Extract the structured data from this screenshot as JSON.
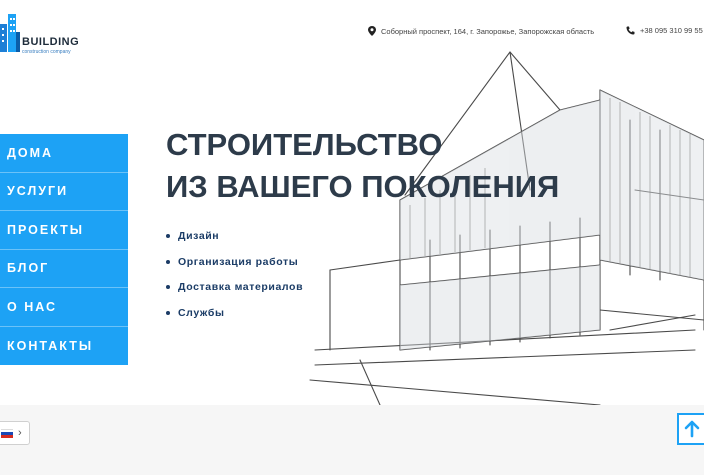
{
  "logo": {
    "title": "BUILDING",
    "subtitle": "construction company"
  },
  "header": {
    "address": "Соборный проспект, 164, г. Запорожье, Запорожская область",
    "phone": "+38 095 310 99 55"
  },
  "nav": {
    "items": [
      "ДОМА",
      "УСЛУГИ",
      "ПРОЕКТЫ",
      "БЛОГ",
      "О НАС",
      "КОНТАКТЫ"
    ]
  },
  "hero": {
    "headline_line1": "СТРОИТЕЛЬСТВО",
    "headline_line2": "ИЗ ВАШЕГО ПОКОЛЕНИЯ",
    "services": [
      "Дизайн",
      "Организация работы",
      "Доставка материалов",
      "Службы"
    ]
  },
  "icons": {
    "address": "location-pin-icon",
    "phone": "phone-icon",
    "language": "russian-flag-icon",
    "scroll_top": "arrow-up-icon"
  },
  "colors": {
    "accent": "#1da2f5",
    "headline": "#2d3b4a",
    "services": "#1b3c66"
  }
}
